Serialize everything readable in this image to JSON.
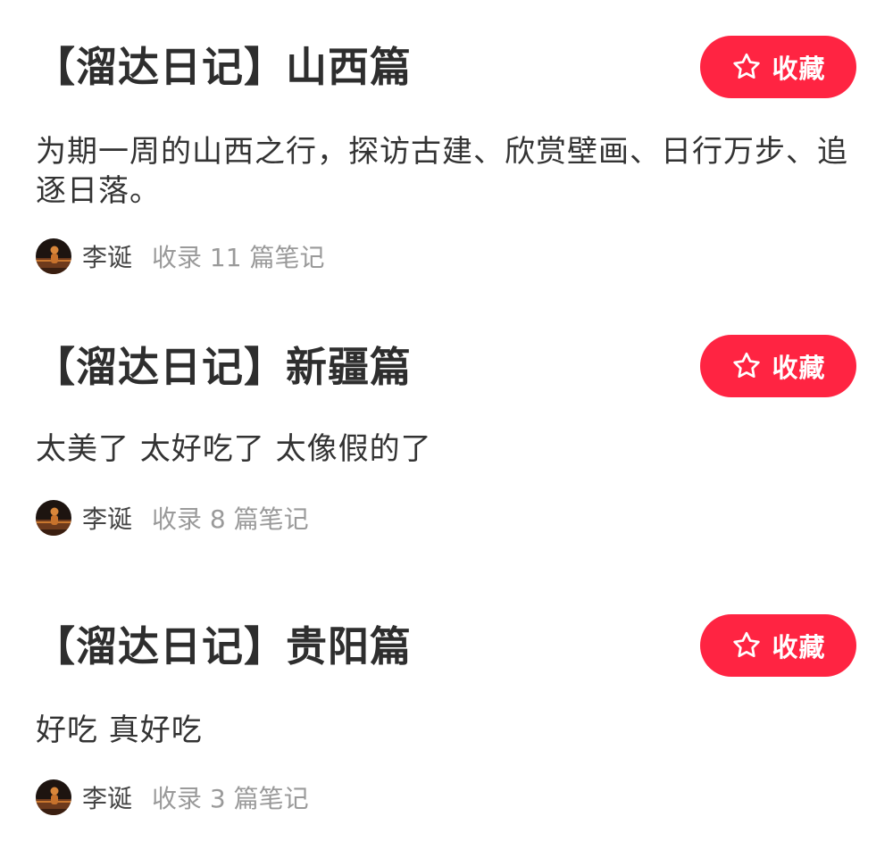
{
  "collections": [
    {
      "title": "【溜达日记】山西篇",
      "description": "为期一周的山西之行，探访古建、欣赏壁画、日行万步、追逐日落。",
      "author": "李诞",
      "count_text": "收录 11 篇笔记",
      "collect_label": "收藏"
    },
    {
      "title": "【溜达日记】新疆篇",
      "description": "太美了 太好吃了 太像假的了",
      "author": "李诞",
      "count_text": "收录 8 篇笔记",
      "collect_label": "收藏"
    },
    {
      "title": "【溜达日记】贵阳篇",
      "description": "好吃 真好吃",
      "author": "李诞",
      "count_text": "收录 3 篇笔记",
      "collect_label": "收藏"
    }
  ],
  "colors": {
    "accent": "#ff2442",
    "title_text": "#2e2e2e",
    "meta_text": "#9a9a9a"
  },
  "icons": {
    "collect": "star-outline-icon",
    "avatar": "user-avatar"
  }
}
